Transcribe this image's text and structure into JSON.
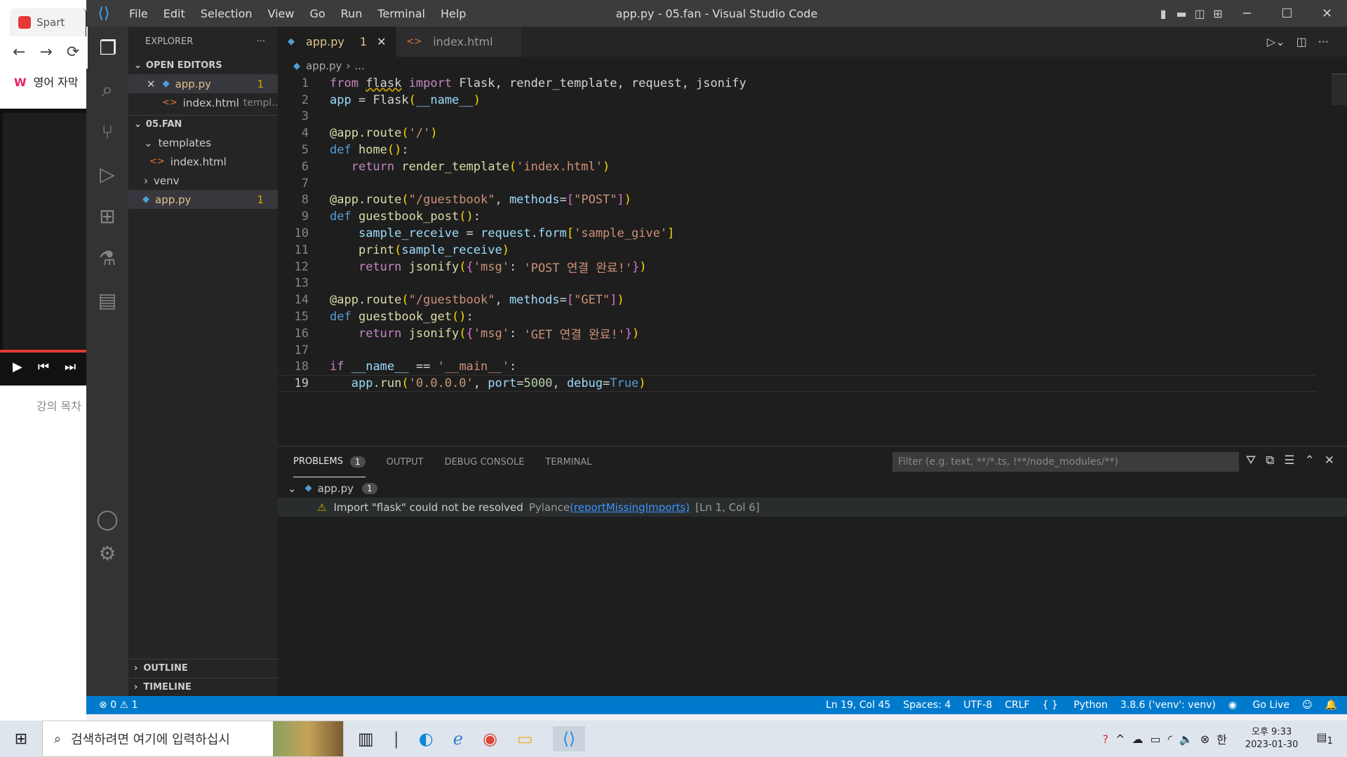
{
  "browser": {
    "tab_title": "Spart",
    "korean_tab": "영어 자막",
    "toc_label": "강의 목차"
  },
  "window": {
    "title": "app.py - 05.fan - Visual Studio Code"
  },
  "menu": [
    "File",
    "Edit",
    "Selection",
    "View",
    "Go",
    "Run",
    "Terminal",
    "Help"
  ],
  "sidebar": {
    "explorer_label": "EXPLORER",
    "open_editors_label": "OPEN EDITORS",
    "open_editors": [
      {
        "name": "app.py",
        "count": "1"
      },
      {
        "name": "index.html",
        "path": "templ..."
      }
    ],
    "folder_label": "05.FAN",
    "tree": {
      "templates": "templates",
      "index": "index.html",
      "venv": "venv",
      "app": "app.py",
      "app_count": "1"
    },
    "outline_label": "OUTLINE",
    "timeline_label": "TIMELINE"
  },
  "tabs": [
    {
      "label": "app.py",
      "count": "1"
    },
    {
      "label": "index.html"
    }
  ],
  "breadcrumb": {
    "file": "app.py",
    "rest": "..."
  },
  "code_lines": [
    "1",
    "2",
    "3",
    "4",
    "5",
    "6",
    "7",
    "8",
    "9",
    "10",
    "11",
    "12",
    "13",
    "14",
    "15",
    "16",
    "17",
    "18",
    "19"
  ],
  "panel": {
    "tabs": [
      "PROBLEMS",
      "OUTPUT",
      "DEBUG CONSOLE",
      "TERMINAL"
    ],
    "problems_count": "1",
    "filter_placeholder": "Filter (e.g. text, **/*.ts, !**/node_modules/**)",
    "file": "app.py",
    "file_count": "1",
    "issue_text": "Import \"flask\" could not be resolved",
    "issue_source": "Pylance",
    "issue_code": "(reportMissingImports)",
    "issue_pos": "[Ln 1, Col 6]"
  },
  "status": {
    "errors": "0",
    "warnings": "1",
    "position": "Ln 19, Col 45",
    "spaces": "Spaces: 4",
    "encoding": "UTF-8",
    "eol": "CRLF",
    "language": "Python",
    "interpreter": "3.8.6 ('venv': venv)",
    "golive": "Go Live"
  },
  "taskbar": {
    "search_placeholder": "검색하려면 여기에 입력하십시",
    "time": "오후 9:33",
    "date": "2023-01-30",
    "ime": "한",
    "notif_count": "1"
  }
}
